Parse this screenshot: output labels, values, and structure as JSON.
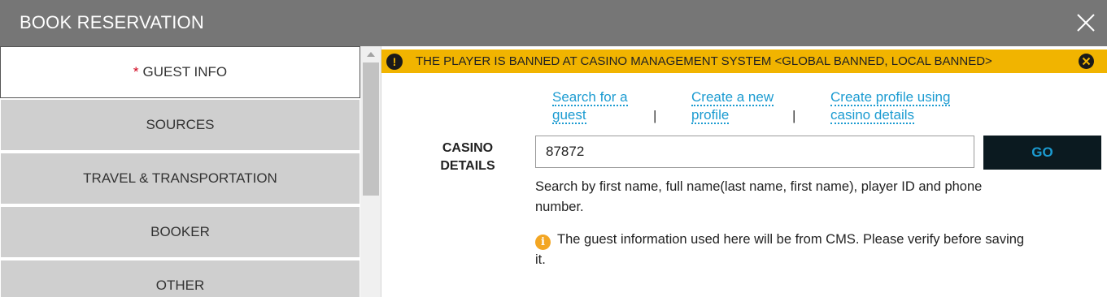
{
  "header": {
    "title": "BOOK RESERVATION"
  },
  "sidebar": {
    "required_marker": "*",
    "items": [
      {
        "label": "GUEST INFO",
        "required": true,
        "active": true
      },
      {
        "label": "SOURCES"
      },
      {
        "label": "TRAVEL & TRANSPORTATION"
      },
      {
        "label": "BOOKER"
      },
      {
        "label": "OTHER"
      }
    ]
  },
  "banner": {
    "icon": "!",
    "message": "THE PLAYER IS BANNED AT CASINO MANAGEMENT SYSTEM <GLOBAL BANNED, LOCAL BANNED>"
  },
  "links": {
    "search_guest": [
      "Search for a",
      "guest"
    ],
    "create_profile": [
      "Create a new",
      "profile"
    ],
    "create_from_casino": [
      "Create profile using",
      "casino details"
    ],
    "separator": "|"
  },
  "casino": {
    "label_line1": "CASINO",
    "label_line2": "DETAILS",
    "input_value": "87872",
    "go_label": "GO"
  },
  "hint": "Search by first name, full name(last name, first name), player ID and phone number.",
  "info_note": {
    "icon": "i",
    "text": "The guest information used here will be from CMS. Please verify before saving it."
  },
  "colors": {
    "title_bar": "#767676",
    "banner": "#f1b400",
    "link": "#1b9bd1",
    "go_button_bg": "#0b1a20",
    "info_icon": "#f3a623",
    "required_marker": "#d0021b"
  }
}
